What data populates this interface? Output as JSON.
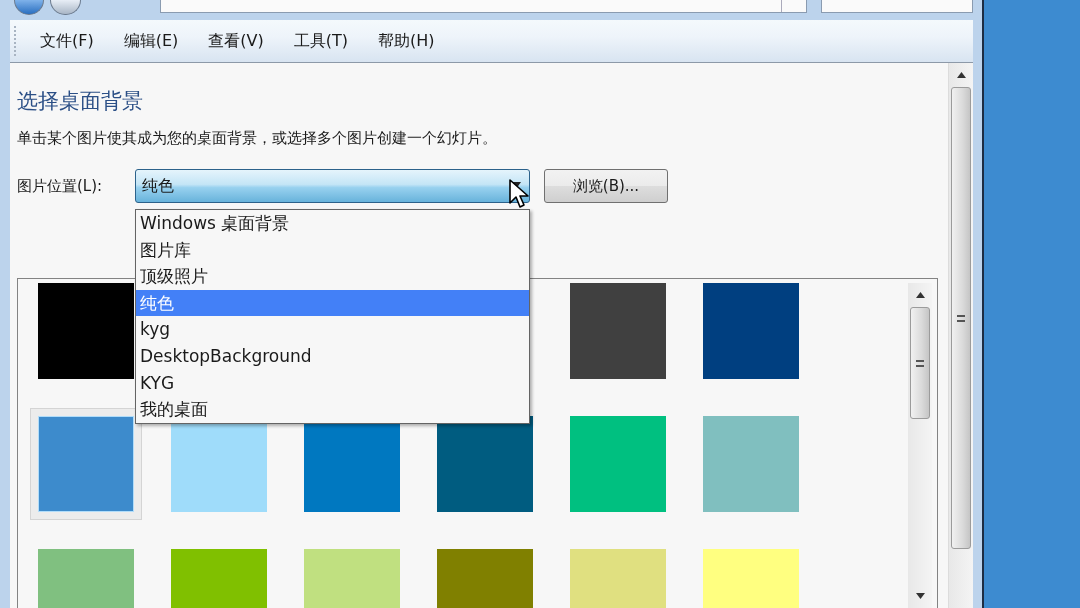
{
  "menu": [
    {
      "label": "文件(F)"
    },
    {
      "label": "编辑(E)"
    },
    {
      "label": "查看(V)"
    },
    {
      "label": "工具(T)"
    },
    {
      "label": "帮助(H)"
    }
  ],
  "title": "选择桌面背景",
  "description": "单击某个图片使其成为您的桌面背景，或选择多个图片创建一个幻灯片。",
  "location": {
    "label": "图片位置(L):",
    "value": "纯色",
    "expanded": true,
    "options": [
      {
        "label": "Windows 桌面背景",
        "selected": false
      },
      {
        "label": "图片库",
        "selected": false
      },
      {
        "label": "顶级照片",
        "selected": false
      },
      {
        "label": "纯色",
        "selected": true
      },
      {
        "label": "kyg",
        "selected": false
      },
      {
        "label": "DesktopBackground",
        "selected": false
      },
      {
        "label": "KYG",
        "selected": false
      },
      {
        "label": "我的桌面",
        "selected": false
      }
    ]
  },
  "browse_button": "浏览(B)...",
  "swatches": [
    {
      "kind": "color",
      "color": "#000000",
      "selected": false
    },
    {
      "kind": "hidden"
    },
    {
      "kind": "hidden"
    },
    {
      "kind": "hidden"
    },
    {
      "kind": "color",
      "color": "#404040",
      "selected": false
    },
    {
      "kind": "color",
      "color": "#003f80",
      "selected": false
    },
    {
      "kind": "color",
      "color": "#3d8bcc",
      "selected": true
    },
    {
      "kind": "color",
      "color": "#9fdcfa",
      "selected": false
    },
    {
      "kind": "color",
      "color": "#0078c0",
      "selected": false
    },
    {
      "kind": "color",
      "color": "#005c80",
      "selected": false
    },
    {
      "kind": "color",
      "color": "#00c080",
      "selected": false
    },
    {
      "kind": "color",
      "color": "#80bfbf",
      "selected": false
    },
    {
      "kind": "color",
      "color": "#80c080",
      "selected": false
    },
    {
      "kind": "color",
      "color": "#80c000",
      "selected": false
    },
    {
      "kind": "color",
      "color": "#c0e080",
      "selected": false
    },
    {
      "kind": "color",
      "color": "#808000",
      "selected": false
    },
    {
      "kind": "color",
      "color": "#e0e080",
      "selected": false
    },
    {
      "kind": "color",
      "color": "#ffff80",
      "selected": false
    }
  ]
}
